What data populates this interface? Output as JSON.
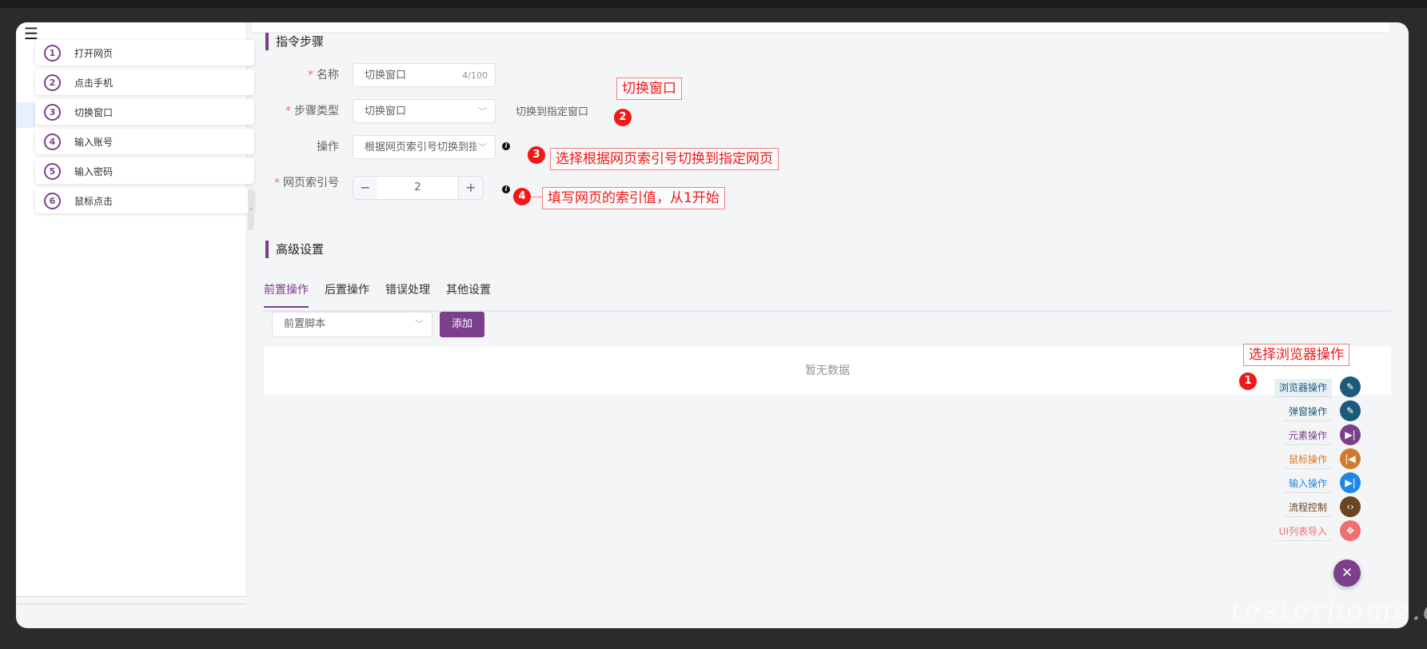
{
  "sidebar": {
    "steps": [
      {
        "num": "1",
        "label": "打开网页"
      },
      {
        "num": "2",
        "label": "点击手机"
      },
      {
        "num": "3",
        "label": "切换窗口"
      },
      {
        "num": "4",
        "label": "输入账号"
      },
      {
        "num": "5",
        "label": "输入密码"
      },
      {
        "num": "6",
        "label": "鼠标点击"
      }
    ]
  },
  "instruction_section": {
    "title": "指令步骤",
    "name": {
      "label": "名称",
      "value": "切换窗口",
      "counter": "4/100"
    },
    "step_type": {
      "label": "步骤类型",
      "value": "切换窗口",
      "help": "切换到指定窗口"
    },
    "operation": {
      "label": "操作",
      "value": "根据网页索引号切换到指定网页"
    },
    "page_index": {
      "label": "网页索引号",
      "value": "2",
      "minus": "−",
      "plus": "+"
    }
  },
  "advanced_section": {
    "title": "高级设置",
    "tabs": [
      "前置操作",
      "后置操作",
      "错误处理",
      "其他设置"
    ],
    "active_tab": "前置操作",
    "script_select": "前置脚本",
    "add_button": "添加",
    "empty_text": "暂无数据"
  },
  "annotations": {
    "n1": "1",
    "n2": "2",
    "n3": "3",
    "n4": "4",
    "switch_window": "切换窗口",
    "select_op": "选择根据网页索引号切换到指定网页",
    "fill_index": "填写网页的索引值，从1开始",
    "select_browser": "选择浏览器操作"
  },
  "fab_menu": {
    "items": [
      {
        "label": "浏览器操作",
        "icon": "pencil-icon",
        "color": "#1b5a7a"
      },
      {
        "label": "弹窗操作",
        "icon": "pencil-icon",
        "color": "#1b5a7a"
      },
      {
        "label": "元素操作",
        "icon": "skip-forward-icon",
        "color": "#7b3f8c"
      },
      {
        "label": "鼠标操作",
        "icon": "skip-back-icon",
        "color": "#d07a2e"
      },
      {
        "label": "输入操作",
        "icon": "skip-forward-icon",
        "color": "#1e88e5"
      },
      {
        "label": "流程控制",
        "icon": "code-icon",
        "color": "#6b4423"
      },
      {
        "label": "UI列表导入",
        "icon": "move-icon",
        "color": "#f06f6f"
      }
    ],
    "main_icon": "close-icon",
    "main_glyph": "✕"
  },
  "watermark": "testerhome.com",
  "colors": {
    "accent": "#7b3f8c",
    "annotation": "#f21818"
  }
}
